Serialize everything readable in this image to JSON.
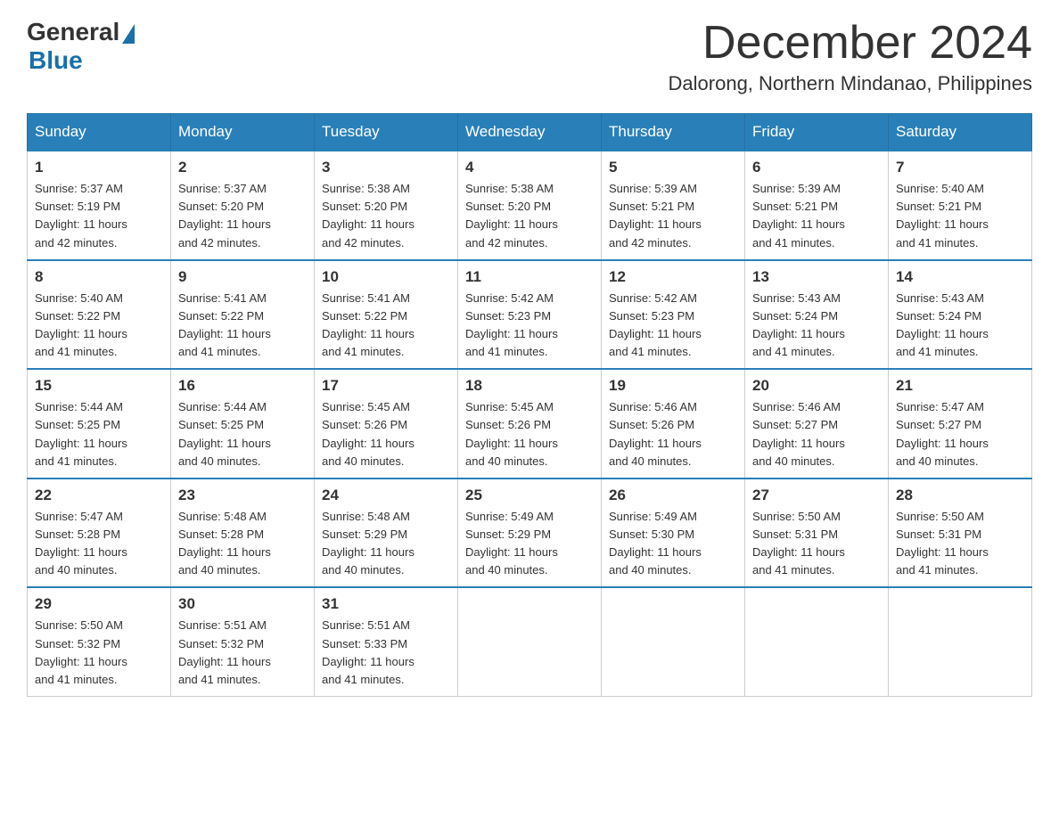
{
  "logo": {
    "general": "General",
    "blue": "Blue"
  },
  "title": {
    "month": "December 2024",
    "location": "Dalorong, Northern Mindanao, Philippines"
  },
  "headers": [
    "Sunday",
    "Monday",
    "Tuesday",
    "Wednesday",
    "Thursday",
    "Friday",
    "Saturday"
  ],
  "weeks": [
    [
      {
        "day": "1",
        "sunrise": "5:37 AM",
        "sunset": "5:19 PM",
        "daylight": "11 hours and 42 minutes."
      },
      {
        "day": "2",
        "sunrise": "5:37 AM",
        "sunset": "5:20 PM",
        "daylight": "11 hours and 42 minutes."
      },
      {
        "day": "3",
        "sunrise": "5:38 AM",
        "sunset": "5:20 PM",
        "daylight": "11 hours and 42 minutes."
      },
      {
        "day": "4",
        "sunrise": "5:38 AM",
        "sunset": "5:20 PM",
        "daylight": "11 hours and 42 minutes."
      },
      {
        "day": "5",
        "sunrise": "5:39 AM",
        "sunset": "5:21 PM",
        "daylight": "11 hours and 42 minutes."
      },
      {
        "day": "6",
        "sunrise": "5:39 AM",
        "sunset": "5:21 PM",
        "daylight": "11 hours and 41 minutes."
      },
      {
        "day": "7",
        "sunrise": "5:40 AM",
        "sunset": "5:21 PM",
        "daylight": "11 hours and 41 minutes."
      }
    ],
    [
      {
        "day": "8",
        "sunrise": "5:40 AM",
        "sunset": "5:22 PM",
        "daylight": "11 hours and 41 minutes."
      },
      {
        "day": "9",
        "sunrise": "5:41 AM",
        "sunset": "5:22 PM",
        "daylight": "11 hours and 41 minutes."
      },
      {
        "day": "10",
        "sunrise": "5:41 AM",
        "sunset": "5:22 PM",
        "daylight": "11 hours and 41 minutes."
      },
      {
        "day": "11",
        "sunrise": "5:42 AM",
        "sunset": "5:23 PM",
        "daylight": "11 hours and 41 minutes."
      },
      {
        "day": "12",
        "sunrise": "5:42 AM",
        "sunset": "5:23 PM",
        "daylight": "11 hours and 41 minutes."
      },
      {
        "day": "13",
        "sunrise": "5:43 AM",
        "sunset": "5:24 PM",
        "daylight": "11 hours and 41 minutes."
      },
      {
        "day": "14",
        "sunrise": "5:43 AM",
        "sunset": "5:24 PM",
        "daylight": "11 hours and 41 minutes."
      }
    ],
    [
      {
        "day": "15",
        "sunrise": "5:44 AM",
        "sunset": "5:25 PM",
        "daylight": "11 hours and 41 minutes."
      },
      {
        "day": "16",
        "sunrise": "5:44 AM",
        "sunset": "5:25 PM",
        "daylight": "11 hours and 40 minutes."
      },
      {
        "day": "17",
        "sunrise": "5:45 AM",
        "sunset": "5:26 PM",
        "daylight": "11 hours and 40 minutes."
      },
      {
        "day": "18",
        "sunrise": "5:45 AM",
        "sunset": "5:26 PM",
        "daylight": "11 hours and 40 minutes."
      },
      {
        "day": "19",
        "sunrise": "5:46 AM",
        "sunset": "5:26 PM",
        "daylight": "11 hours and 40 minutes."
      },
      {
        "day": "20",
        "sunrise": "5:46 AM",
        "sunset": "5:27 PM",
        "daylight": "11 hours and 40 minutes."
      },
      {
        "day": "21",
        "sunrise": "5:47 AM",
        "sunset": "5:27 PM",
        "daylight": "11 hours and 40 minutes."
      }
    ],
    [
      {
        "day": "22",
        "sunrise": "5:47 AM",
        "sunset": "5:28 PM",
        "daylight": "11 hours and 40 minutes."
      },
      {
        "day": "23",
        "sunrise": "5:48 AM",
        "sunset": "5:28 PM",
        "daylight": "11 hours and 40 minutes."
      },
      {
        "day": "24",
        "sunrise": "5:48 AM",
        "sunset": "5:29 PM",
        "daylight": "11 hours and 40 minutes."
      },
      {
        "day": "25",
        "sunrise": "5:49 AM",
        "sunset": "5:29 PM",
        "daylight": "11 hours and 40 minutes."
      },
      {
        "day": "26",
        "sunrise": "5:49 AM",
        "sunset": "5:30 PM",
        "daylight": "11 hours and 40 minutes."
      },
      {
        "day": "27",
        "sunrise": "5:50 AM",
        "sunset": "5:31 PM",
        "daylight": "11 hours and 41 minutes."
      },
      {
        "day": "28",
        "sunrise": "5:50 AM",
        "sunset": "5:31 PM",
        "daylight": "11 hours and 41 minutes."
      }
    ],
    [
      {
        "day": "29",
        "sunrise": "5:50 AM",
        "sunset": "5:32 PM",
        "daylight": "11 hours and 41 minutes."
      },
      {
        "day": "30",
        "sunrise": "5:51 AM",
        "sunset": "5:32 PM",
        "daylight": "11 hours and 41 minutes."
      },
      {
        "day": "31",
        "sunrise": "5:51 AM",
        "sunset": "5:33 PM",
        "daylight": "11 hours and 41 minutes."
      },
      null,
      null,
      null,
      null
    ]
  ],
  "labels": {
    "sunrise": "Sunrise:",
    "sunset": "Sunset:",
    "daylight": "Daylight:"
  }
}
